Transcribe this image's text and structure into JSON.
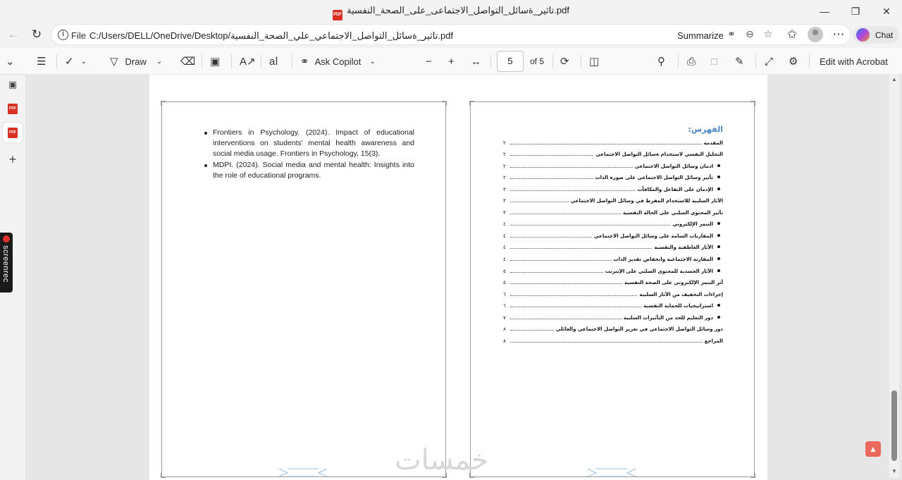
{
  "window": {
    "title": "تاثير_ةسائل_التواصل_الاجتماعى_على_الصحة_النفسية.pdf",
    "pdf_badge": "PDF"
  },
  "address_bar": {
    "file_label": "File",
    "url": "C:/Users/DELL/OneDrive/Desktop/تاثير_ةسائل_التواصل_الاجتماعي_علي_الصحة_النفسية.pdf",
    "summarize_label": "Summarize",
    "chat_label": "Chat"
  },
  "toolbar": {
    "draw_label": "Draw",
    "ask_copilot_label": "Ask Copilot",
    "current_page": "5",
    "of_pages": "of 5",
    "edit_acrobat_label": "Edit with Acrobat"
  },
  "left_page": {
    "references": [
      "Frontiers in Psychology. (2024). Impact of educational interventions on students' mental health awareness and social media usage. Frontiers in Psychology, 15(3).",
      "MDPI. (2024). Social media and mental health: Insights into the role of educational programs."
    ]
  },
  "right_page": {
    "toc_title": "الفهرس:",
    "entries": [
      {
        "text": "المقدمة",
        "page": "٢",
        "sub": false
      },
      {
        "text": "التحليل النفسي لاستخدام ةسائل التواصل الاجتماعي",
        "page": "٢",
        "sub": false
      },
      {
        "text": "ادمان وسائل التواصل الاجتماعي",
        "page": "٢",
        "sub": true
      },
      {
        "text": "تأثير وسائل التواصل الاجتماعي على صورة الذات",
        "page": "٢",
        "sub": true
      },
      {
        "text": "الإدمان على التفاعل والمكافآت",
        "page": "٣",
        "sub": true
      },
      {
        "text": "الآثار السلبية للاستخدام المفرط في وسائل التواصل الاجتماعي",
        "page": "٣",
        "sub": false
      },
      {
        "text": "تأثير المحتوي السلبي على الحالة النفسية",
        "page": "٣",
        "sub": false
      },
      {
        "text": "التنمر الإلكتروني",
        "page": "٤",
        "sub": true
      },
      {
        "text": "المقارنات السامة على وسائل التواصل الاجتماعي",
        "page": "٤",
        "sub": true
      },
      {
        "text": "الآثار العاطفية والنفسية",
        "page": "٤",
        "sub": true
      },
      {
        "text": "المقارنة الاجتماعية وانخفاض تقدير الذات",
        "page": "٤",
        "sub": true
      },
      {
        "text": "الآثار الجسدية للمحتوى السلبي على الإنترنت",
        "page": "٥",
        "sub": true
      },
      {
        "text": "أثر التنمر الإلكتروني على الصحة النفسية",
        "page": "٥",
        "sub": false
      },
      {
        "text": "إجراءات التخفيف من الآثار السلبية",
        "page": "٦",
        "sub": false
      },
      {
        "text": "استراتيجيات للحماية النفسية",
        "page": "٦",
        "sub": true
      },
      {
        "text": "دور التعليم للحد من التأثيرات السلبية",
        "page": "٧",
        "sub": true
      },
      {
        "text": "دور وسائل التواصل الاجتماعي في تعزيز التواصل الاجتماعي والعائلي",
        "page": "٨",
        "sub": false
      },
      {
        "text": "المراجع",
        "page": "٨",
        "sub": false
      }
    ]
  },
  "sidebar": {
    "screenrec_label": "screenrec"
  },
  "watermark": "خمسات"
}
